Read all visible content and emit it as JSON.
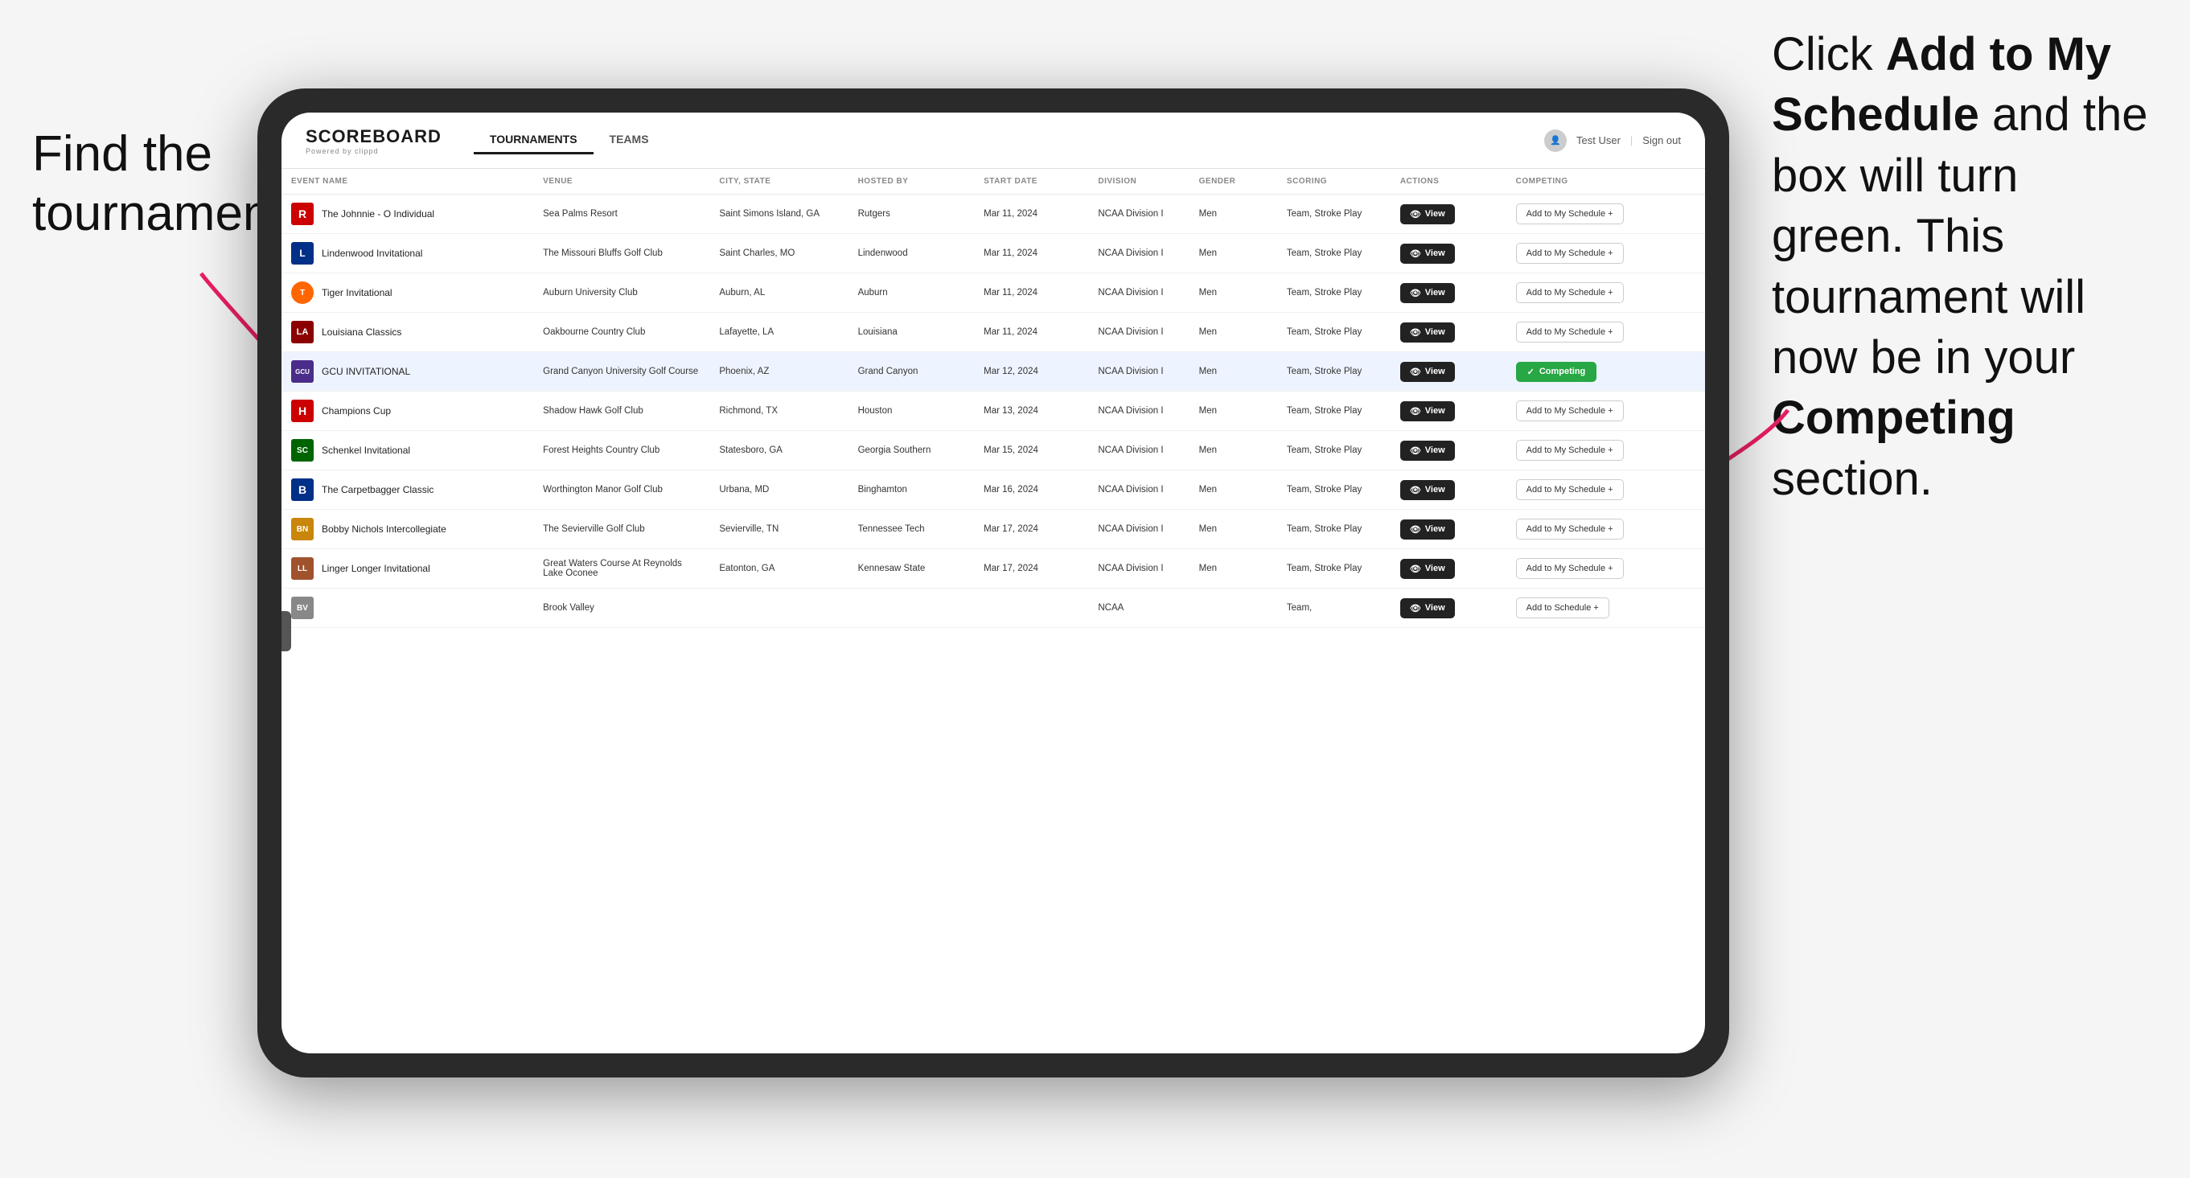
{
  "annotations": {
    "left_text_line1": "Find the",
    "left_text_line2": "tournament.",
    "right_text": "Click ",
    "right_bold1": "Add to My Schedule",
    "right_mid": " and the box will turn green. This tournament will now be in your ",
    "right_bold2": "Competing",
    "right_end": " section."
  },
  "navbar": {
    "logo": "SCOREBOARD",
    "logo_sub": "Powered by clippd",
    "nav_items": [
      "TOURNAMENTS",
      "TEAMS"
    ],
    "active_nav": "TOURNAMENTS",
    "user_text": "Test User",
    "sign_out": "Sign out"
  },
  "table": {
    "headers": [
      "EVENT NAME",
      "VENUE",
      "CITY, STATE",
      "HOSTED BY",
      "START DATE",
      "DIVISION",
      "GENDER",
      "SCORING",
      "ACTIONS",
      "COMPETING"
    ],
    "rows": [
      {
        "id": 1,
        "logo_class": "logo-r",
        "logo_text": "R",
        "event_name": "The Johnnie - O Individual",
        "venue": "Sea Palms Resort",
        "city_state": "Saint Simons Island, GA",
        "hosted_by": "Rutgers",
        "start_date": "Mar 11, 2024",
        "division": "NCAA Division I",
        "gender": "Men",
        "scoring": "Team, Stroke Play",
        "action_label": "View",
        "competing_label": "Add to My Schedule +",
        "is_competing": false,
        "highlighted": false
      },
      {
        "id": 2,
        "logo_class": "logo-l",
        "logo_text": "L",
        "event_name": "Lindenwood Invitational",
        "venue": "The Missouri Bluffs Golf Club",
        "city_state": "Saint Charles, MO",
        "hosted_by": "Lindenwood",
        "start_date": "Mar 11, 2024",
        "division": "NCAA Division I",
        "gender": "Men",
        "scoring": "Team, Stroke Play",
        "action_label": "View",
        "competing_label": "Add to My Schedule +",
        "is_competing": false,
        "highlighted": false
      },
      {
        "id": 3,
        "logo_class": "logo-tiger",
        "logo_text": "T",
        "event_name": "Tiger Invitational",
        "venue": "Auburn University Club",
        "city_state": "Auburn, AL",
        "hosted_by": "Auburn",
        "start_date": "Mar 11, 2024",
        "division": "NCAA Division I",
        "gender": "Men",
        "scoring": "Team, Stroke Play",
        "action_label": "View",
        "competing_label": "Add to My Schedule +",
        "is_competing": false,
        "highlighted": false
      },
      {
        "id": 4,
        "logo_class": "logo-la",
        "logo_text": "LA",
        "event_name": "Louisiana Classics",
        "venue": "Oakbourne Country Club",
        "city_state": "Lafayette, LA",
        "hosted_by": "Louisiana",
        "start_date": "Mar 11, 2024",
        "division": "NCAA Division I",
        "gender": "Men",
        "scoring": "Team, Stroke Play",
        "action_label": "View",
        "competing_label": "Add to My Schedule +",
        "is_competing": false,
        "highlighted": false
      },
      {
        "id": 5,
        "logo_class": "logo-gcu",
        "logo_text": "GCU",
        "event_name": "GCU INVITATIONAL",
        "venue": "Grand Canyon University Golf Course",
        "city_state": "Phoenix, AZ",
        "hosted_by": "Grand Canyon",
        "start_date": "Mar 12, 2024",
        "division": "NCAA Division I",
        "gender": "Men",
        "scoring": "Team, Stroke Play",
        "action_label": "View",
        "competing_label": "Competing",
        "is_competing": true,
        "highlighted": true
      },
      {
        "id": 6,
        "logo_class": "logo-h",
        "logo_text": "H",
        "event_name": "Champions Cup",
        "venue": "Shadow Hawk Golf Club",
        "city_state": "Richmond, TX",
        "hosted_by": "Houston",
        "start_date": "Mar 13, 2024",
        "division": "NCAA Division I",
        "gender": "Men",
        "scoring": "Team, Stroke Play",
        "action_label": "View",
        "competing_label": "Add to My Schedule +",
        "is_competing": false,
        "highlighted": false
      },
      {
        "id": 7,
        "logo_class": "logo-sc",
        "logo_text": "SC",
        "event_name": "Schenkel Invitational",
        "venue": "Forest Heights Country Club",
        "city_state": "Statesboro, GA",
        "hosted_by": "Georgia Southern",
        "start_date": "Mar 15, 2024",
        "division": "NCAA Division I",
        "gender": "Men",
        "scoring": "Team, Stroke Play",
        "action_label": "View",
        "competing_label": "Add to My Schedule +",
        "is_competing": false,
        "highlighted": false
      },
      {
        "id": 8,
        "logo_class": "logo-b",
        "logo_text": "B",
        "event_name": "The Carpetbagger Classic",
        "venue": "Worthington Manor Golf Club",
        "city_state": "Urbana, MD",
        "hosted_by": "Binghamton",
        "start_date": "Mar 16, 2024",
        "division": "NCAA Division I",
        "gender": "Men",
        "scoring": "Team, Stroke Play",
        "action_label": "View",
        "competing_label": "Add to My Schedule +",
        "is_competing": false,
        "highlighted": false
      },
      {
        "id": 9,
        "logo_class": "logo-bn",
        "logo_text": "BN",
        "event_name": "Bobby Nichols Intercollegiate",
        "venue": "The Sevierville Golf Club",
        "city_state": "Sevierville, TN",
        "hosted_by": "Tennessee Tech",
        "start_date": "Mar 17, 2024",
        "division": "NCAA Division I",
        "gender": "Men",
        "scoring": "Team, Stroke Play",
        "action_label": "View",
        "competing_label": "Add to My Schedule +",
        "is_competing": false,
        "highlighted": false
      },
      {
        "id": 10,
        "logo_class": "logo-ll",
        "logo_text": "LL",
        "event_name": "Linger Longer Invitational",
        "venue": "Great Waters Course At Reynolds Lake Oconee",
        "city_state": "Eatonton, GA",
        "hosted_by": "Kennesaw State",
        "start_date": "Mar 17, 2024",
        "division": "NCAA Division I",
        "gender": "Men",
        "scoring": "Team, Stroke Play",
        "action_label": "View",
        "competing_label": "Add to My Schedule +",
        "is_competing": false,
        "highlighted": false
      },
      {
        "id": 11,
        "logo_class": "logo-bv",
        "logo_text": "BV",
        "event_name": "",
        "venue": "Brook Valley",
        "city_state": "",
        "hosted_by": "",
        "start_date": "",
        "division": "NCAA",
        "gender": "",
        "scoring": "Team,",
        "action_label": "View",
        "competing_label": "Add to Schedule +",
        "is_competing": false,
        "highlighted": false,
        "partial": true
      }
    ]
  }
}
